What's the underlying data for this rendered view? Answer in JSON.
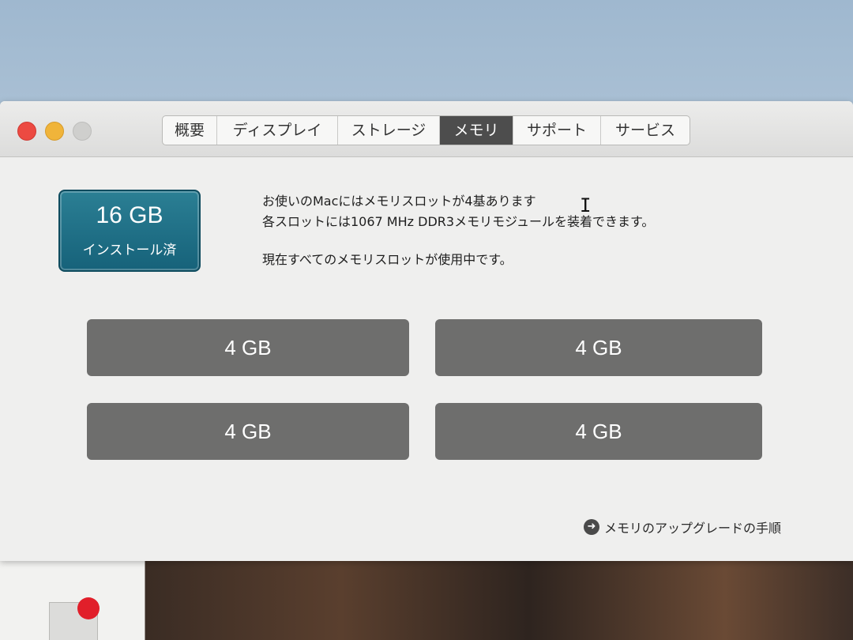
{
  "window": {
    "tabs": [
      "概要",
      "ディスプレイ",
      "ストレージ",
      "メモリ",
      "サポート",
      "サービス"
    ],
    "active_tab": "メモリ"
  },
  "memory": {
    "installed_size": "16 GB",
    "installed_label": "インストール済",
    "info_line1": "お使いのMacにはメモリスロットが4基あります",
    "info_line2": "各スロットには1067 MHz DDR3メモリモジュールを装着できます。",
    "info_line3": "現在すべてのメモリスロットが使用中です。",
    "slots": [
      "4 GB",
      "4 GB",
      "4 GB",
      "4 GB"
    ],
    "upgrade_link": "メモリのアップグレードの手順"
  },
  "icons": {
    "upgrade": "arrow-right-circle-icon",
    "cursor": "text-cursor-icon"
  },
  "colors": {
    "badge": "#1f6f86",
    "slot": "#6e6e6d",
    "active_tab": "#4d4d4d",
    "close": "#ec4a42",
    "minimize": "#f0b43a"
  }
}
